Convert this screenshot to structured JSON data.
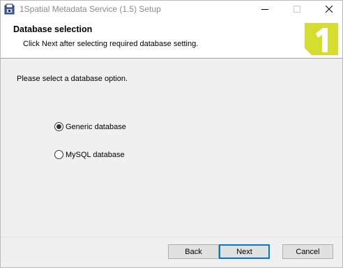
{
  "window": {
    "title": "1Spatial Metadata Service (1.5) Setup",
    "icon": "installer-icon",
    "controls": {
      "minimize": "minimize-icon",
      "maximize": "maximize-icon",
      "close": "close-icon"
    }
  },
  "header": {
    "title": "Database selection",
    "subtitle": "Click Next after selecting required database setting.",
    "logo": {
      "text": "1",
      "colors": {
        "accent": "#d5dd2f",
        "glyph": "#ffffff"
      }
    }
  },
  "main": {
    "prompt": "Please select a database option.",
    "options": [
      {
        "label": "Generic database",
        "checked": true
      },
      {
        "label": "MySQL database",
        "checked": false
      }
    ]
  },
  "buttons": {
    "back": "Back",
    "next": "Next",
    "cancel": "Cancel"
  },
  "colors": {
    "focus_border": "#0078d7",
    "dialog_background": "#f0f0f0"
  }
}
